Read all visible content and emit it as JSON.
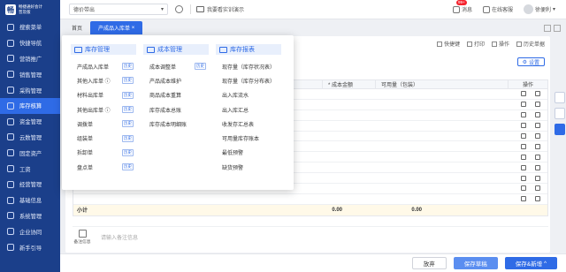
{
  "app": {
    "logo_mark": "畅",
    "name": "畅捷通好会计",
    "sub": "普及版"
  },
  "sidebar": {
    "items": [
      {
        "label": "搜索菜单"
      },
      {
        "label": "快捷导航"
      },
      {
        "label": "营销推广"
      },
      {
        "label": "销售管理"
      },
      {
        "label": "采购管理"
      },
      {
        "label": "库存核算",
        "active": true
      },
      {
        "label": "资金管理"
      },
      {
        "label": "云数管理"
      },
      {
        "label": "固定资产"
      },
      {
        "label": "工资"
      },
      {
        "label": "经营管理"
      },
      {
        "label": "基础信息"
      },
      {
        "label": "系统管理"
      },
      {
        "label": "企业协同"
      },
      {
        "label": "新手引导"
      }
    ]
  },
  "topbar": {
    "workspace": "德价带出",
    "hint": "我要看实训演示",
    "notice": "消息",
    "notice_badge": "99+",
    "service": "在线客服",
    "user": "徐便利"
  },
  "tabs": [
    {
      "label": "首页"
    },
    {
      "label": "产成品入库单",
      "active": true
    }
  ],
  "toolbar": {
    "items": [
      "快捷键",
      "打印",
      "操作",
      "历史单据"
    ],
    "settings": "设置"
  },
  "table": {
    "columns": [
      "* 成本金额",
      "可用量（包装）",
      "操作"
    ],
    "sum_label": "小计",
    "sum_values": [
      "0.00",
      "0.00"
    ]
  },
  "remark": {
    "label": "备注信息",
    "placeholder": "请输入备注信息"
  },
  "footer": {
    "discard": "放弃",
    "save_draft": "保存草稿",
    "save_new": "保存&新增"
  },
  "menu": {
    "columns": [
      {
        "title": "库存管理",
        "items": [
          {
            "label": "产成品入库单",
            "history": "历史"
          },
          {
            "label": "其他入库单 ⓘ",
            "history": "历史"
          },
          {
            "label": "材料出库单",
            "history": "历史"
          },
          {
            "label": "其他出库单 ⓘ",
            "history": "历史"
          },
          {
            "label": "调拨单",
            "history": "历史"
          },
          {
            "label": "组装单",
            "history": "历史"
          },
          {
            "label": "拆卸单",
            "history": "历史"
          },
          {
            "label": "盘点单",
            "history": "历史"
          }
        ]
      },
      {
        "title": "成本管理",
        "items": [
          {
            "label": "成本调整单",
            "history": "历史"
          },
          {
            "label": "产品成本维护"
          },
          {
            "label": "商品成本重算"
          },
          {
            "label": "库存成本总账"
          },
          {
            "label": "库存成本明细账"
          }
        ]
      },
      {
        "title": "库存报表",
        "items": [
          {
            "label": "现存量（库存状况表）"
          },
          {
            "label": "现存量（库存分布表）"
          },
          {
            "label": "出入库流水"
          },
          {
            "label": "出入库汇总"
          },
          {
            "label": "收发存汇总表"
          },
          {
            "label": "可用量库存账本"
          },
          {
            "label": "最低预警"
          },
          {
            "label": "缺货预警"
          }
        ]
      }
    ]
  },
  "colors": {
    "sidebar": "#1b3f8a",
    "accent": "#2f6be6"
  }
}
